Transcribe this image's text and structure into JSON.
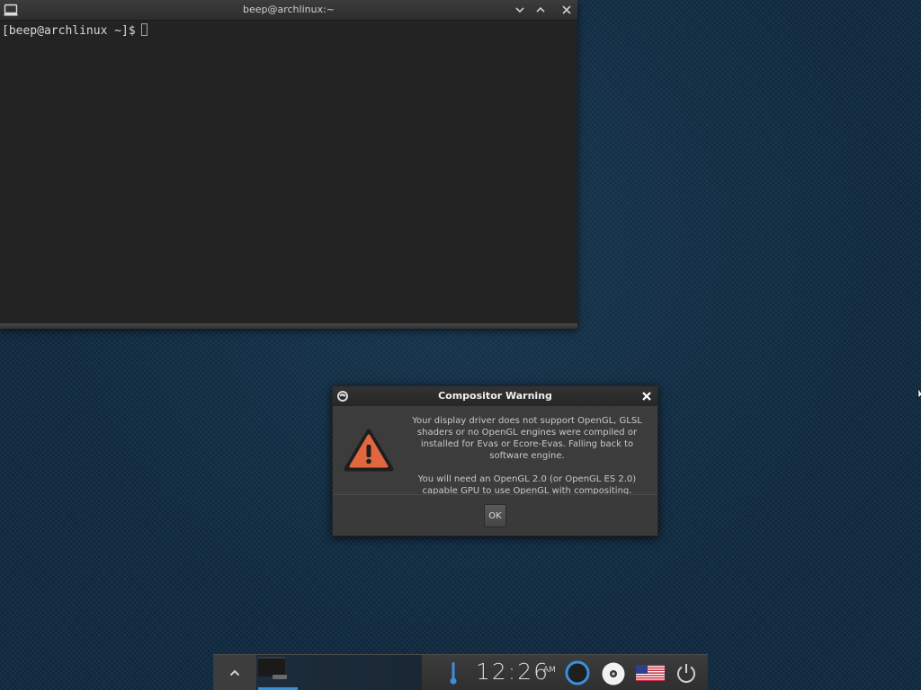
{
  "terminal": {
    "title": "beep@archlinux:~",
    "prompt": "[beep@archlinux ~]$",
    "icons": [
      "terminal-app-icon",
      "minimize-chevron-icon",
      "maximize-chevron-icon",
      "close-x-icon"
    ]
  },
  "dialog": {
    "title": "Compositor Warning",
    "message_1": "Your display driver does not support OpenGL, GLSL shaders or no OpenGL engines were compiled or installed for Evas or Ecore-Evas. Falling back to software engine.",
    "message_2": "You will need an OpenGL 2.0 (or OpenGL ES 2.0) capable GPU to use OpenGL with compositing.",
    "ok_label": "OK",
    "icons": [
      "app-icon",
      "close-x-icon",
      "warning-triangle-icon"
    ]
  },
  "shelf": {
    "clock_time": "12:26",
    "clock_ampm": "AM",
    "icons": [
      "shelf-up-arrow-icon",
      "thermometer-icon",
      "network-ring-icon",
      "disc-icon",
      "us-flag-icon",
      "power-icon"
    ]
  },
  "colors": {
    "accent_blue": "#3a8fdc",
    "warning_orange": "#e2673f",
    "desktop_bg": "#0f2a40"
  }
}
